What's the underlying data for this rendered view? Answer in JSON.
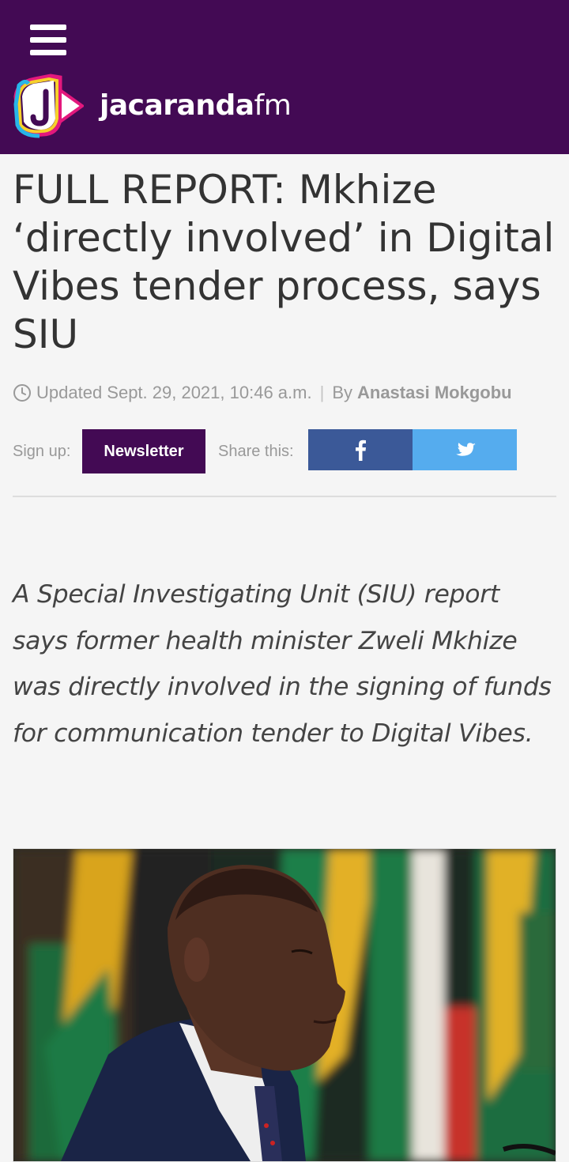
{
  "header": {
    "logo_text_bold": "jacaranda",
    "logo_text_light": "fm",
    "bg_color": "#430a54"
  },
  "article": {
    "title": "FULL REPORT: Mkhize ‘directly involved’ in Digital Vibes tender process, says SIU",
    "updated": "Updated Sept. 29, 2021, 10:46 a.m.",
    "by_label": "By",
    "author": "Anastasi Mokgobu",
    "lead": "A Special Investigating Unit (SIU) report says former health minister Zweli Mkhize was directly involved in the signing of funds for communication tender to Digital Vibes."
  },
  "share": {
    "signup_label": "Sign up:",
    "newsletter_label": "Newsletter",
    "share_label": "Share this:",
    "facebook_icon": "facebook-icon",
    "twitter_icon": "twitter-icon",
    "facebook_color": "#3b5998",
    "twitter_color": "#55acee"
  },
  "photo": {
    "subject": "man-in-suit-in-front-of-south-african-flags"
  }
}
